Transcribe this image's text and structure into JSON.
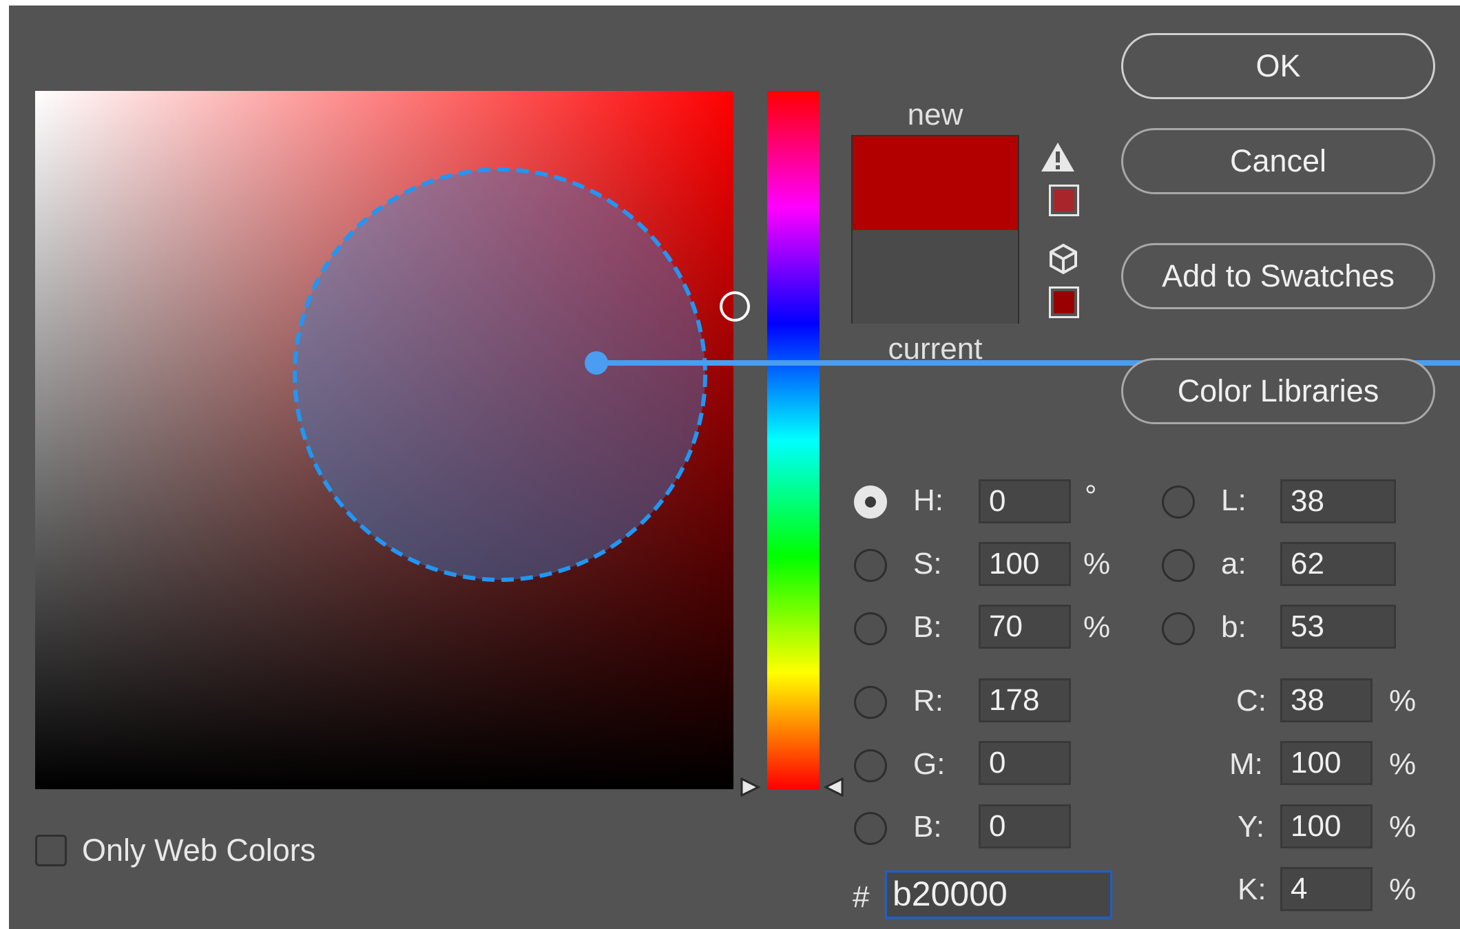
{
  "buttons": {
    "ok": "OK",
    "cancel": "Cancel",
    "add_to_swatches": "Add to Swatches",
    "color_libraries": "Color Libraries"
  },
  "preview": {
    "new_label": "new",
    "current_label": "current",
    "new_color": "#b20000",
    "current_color": "#4a4a4a",
    "gamut_warning_swatch": "#a8262b",
    "web_safe_swatch": "#990000"
  },
  "hsb": {
    "h_label": "H:",
    "h_value": "0",
    "h_unit": "°",
    "s_label": "S:",
    "s_value": "100",
    "s_unit": "%",
    "b_label": "B:",
    "b_value": "70",
    "b_unit": "%"
  },
  "rgb": {
    "r_label": "R:",
    "r_value": "178",
    "g_label": "G:",
    "g_value": "0",
    "b_label": "B:",
    "b_value": "0"
  },
  "lab": {
    "l_label": "L:",
    "l_value": "38",
    "a_label": "a:",
    "a_value": "62",
    "b_label": "b:",
    "b_value": "53"
  },
  "cmyk": {
    "c_label": "C:",
    "c_value": "38",
    "c_unit": "%",
    "m_label": "M:",
    "m_value": "100",
    "m_unit": "%",
    "y_label": "Y:",
    "y_value": "100",
    "y_unit": "%",
    "k_label": "K:",
    "k_value": "4",
    "k_unit": "%"
  },
  "hex": {
    "label": "#",
    "value": "b20000"
  },
  "options": {
    "only_web_colors": "Only Web Colors"
  },
  "icons": {
    "gamut_warning": "warning-triangle-icon",
    "web_safe": "cube-icon"
  },
  "annotation": {
    "color": "#2196f3"
  }
}
